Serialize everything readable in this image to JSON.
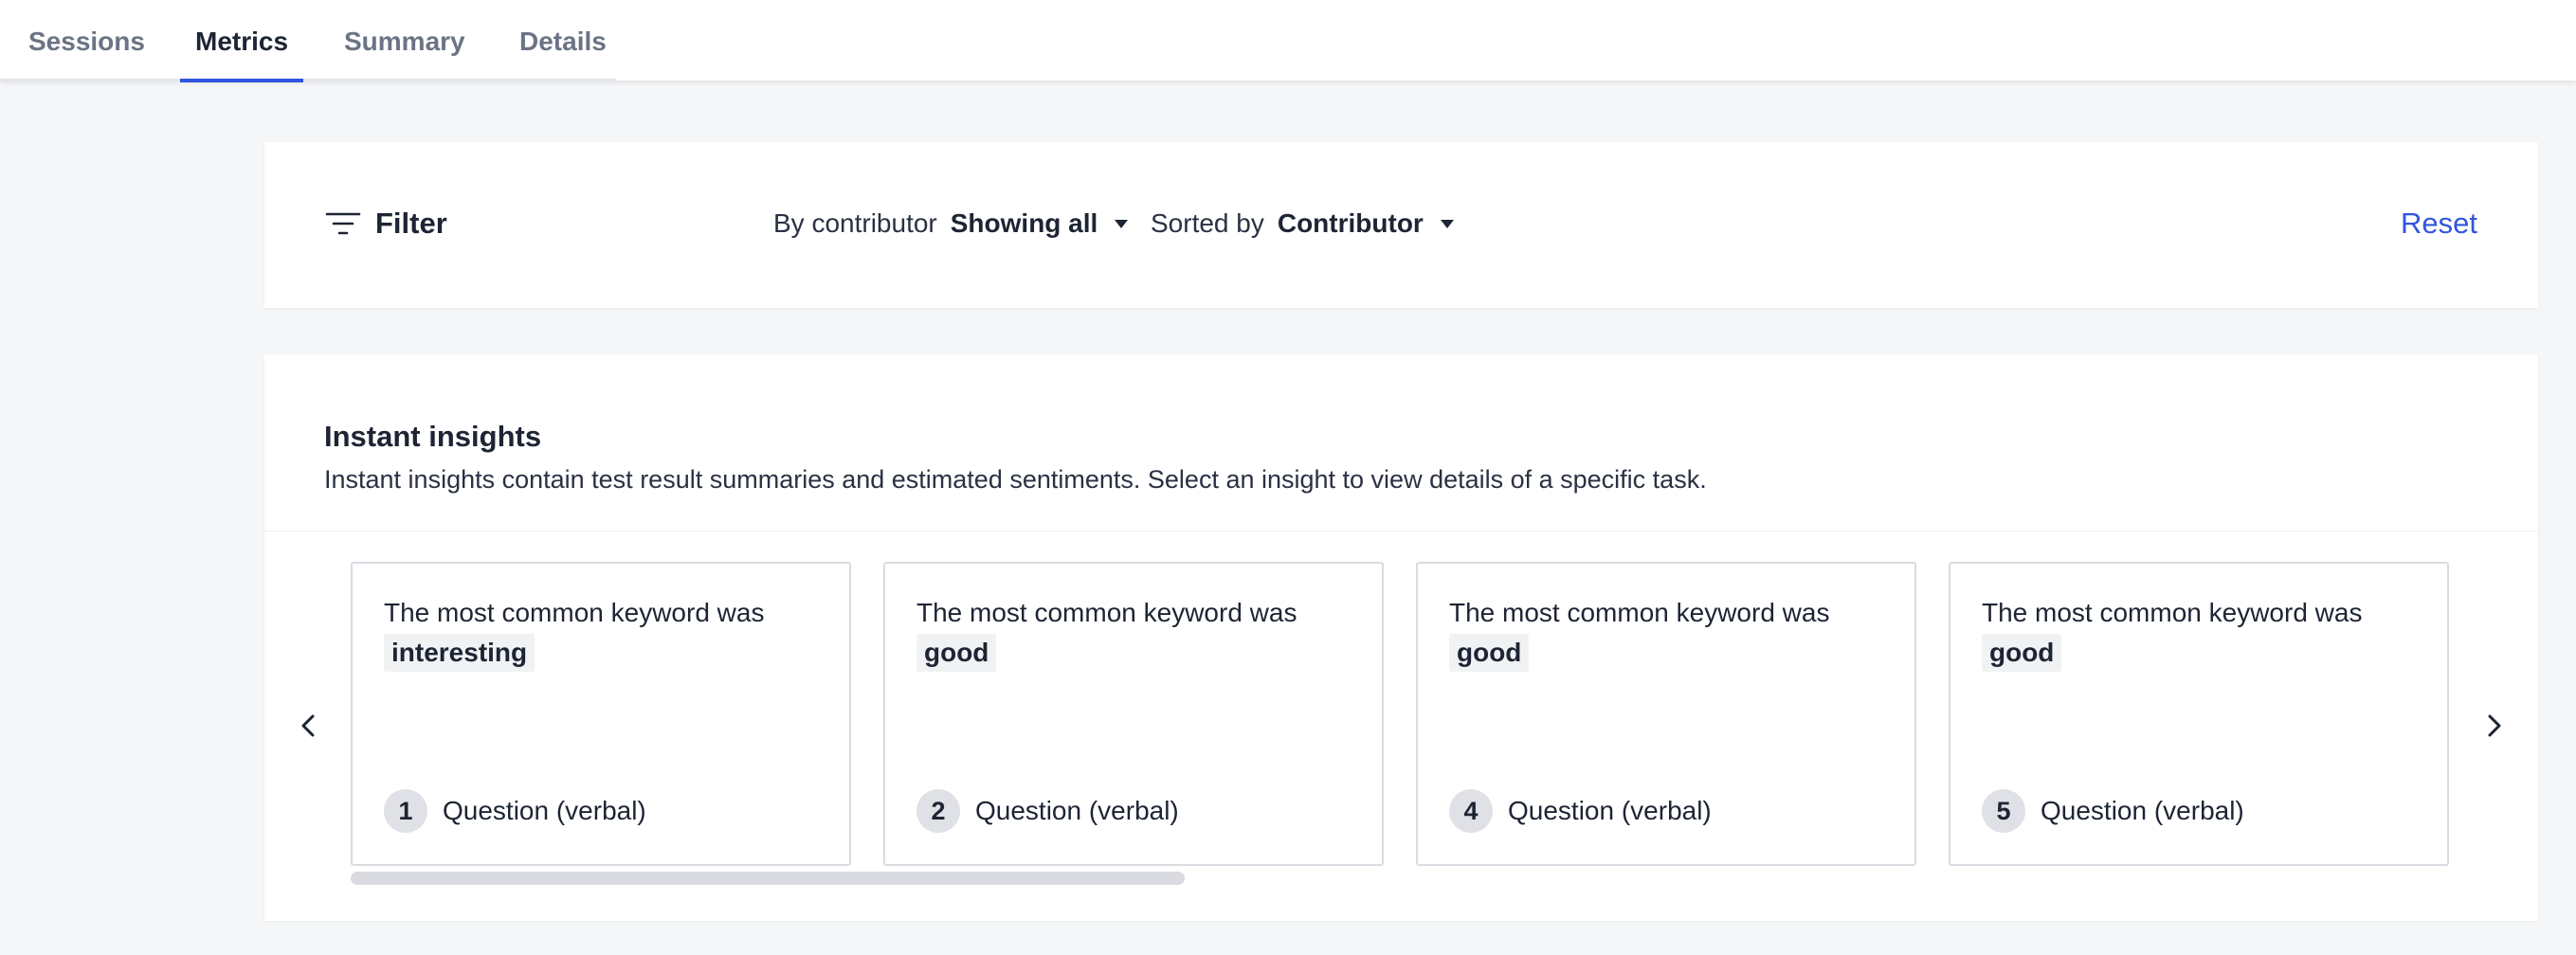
{
  "tabs": [
    {
      "label": "Sessions",
      "active": false
    },
    {
      "label": "Metrics",
      "active": true
    },
    {
      "label": "Summary",
      "active": false
    },
    {
      "label": "Details",
      "active": false
    }
  ],
  "filter": {
    "label": "Filter",
    "icon": "filter-lines-icon",
    "contributor_label": "By contributor",
    "contributor_value": "Showing all",
    "sort_label": "Sorted by",
    "sort_value": "Contributor",
    "reset_label": "Reset"
  },
  "insights": {
    "title": "Instant insights",
    "description": "Instant insights contain test result summaries and estimated sentiments. Select an insight to view details of a specific task.",
    "cards": [
      {
        "text": "The most common keyword was",
        "keyword": "interesting",
        "number": "1",
        "type": "Question (verbal)"
      },
      {
        "text": "The most common keyword was",
        "keyword": "good",
        "number": "2",
        "type": "Question (verbal)"
      },
      {
        "text": "The most common keyword was",
        "keyword": "good",
        "number": "4",
        "type": "Question (verbal)"
      },
      {
        "text": "The most common keyword was",
        "keyword": "good",
        "number": "5",
        "type": "Question (verbal)"
      }
    ]
  },
  "colors": {
    "accent": "#3155e0",
    "text": "#1d2433",
    "background": "#f5f6f8"
  }
}
